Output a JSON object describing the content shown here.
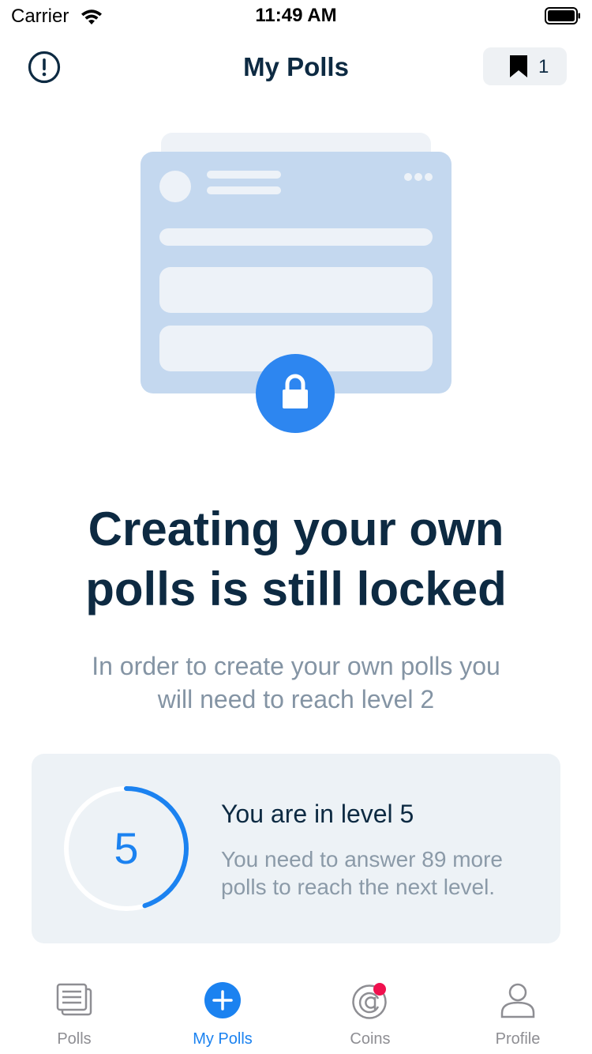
{
  "status_bar": {
    "carrier": "Carrier",
    "time": "11:49 AM"
  },
  "nav": {
    "title": "My Polls",
    "bookmark_count": "1"
  },
  "locked": {
    "title_line1": "Creating your own",
    "title_line2": "polls is still locked",
    "subtitle_line1": "In order to create your own polls you",
    "subtitle_line2": "will need to reach level 2"
  },
  "level": {
    "number": "5",
    "progress": 0.45,
    "title": "You are in level 5",
    "description_line1": "You need to answer 89 more",
    "description_line2": "polls to reach the next level."
  },
  "tabs": [
    {
      "label": "Polls",
      "icon": "polls-icon",
      "active": false
    },
    {
      "label": "My Polls",
      "icon": "add-circle-icon",
      "active": true
    },
    {
      "label": "Coins",
      "icon": "coins-icon",
      "active": false,
      "badge": true
    },
    {
      "label": "Profile",
      "icon": "profile-icon",
      "active": false
    }
  ],
  "colors": {
    "accent": "#1b82f0",
    "navy": "#0d2a42",
    "card_bg": "#edf2f6",
    "illustration": "#c4d8ef",
    "badge": "#f0104e"
  }
}
